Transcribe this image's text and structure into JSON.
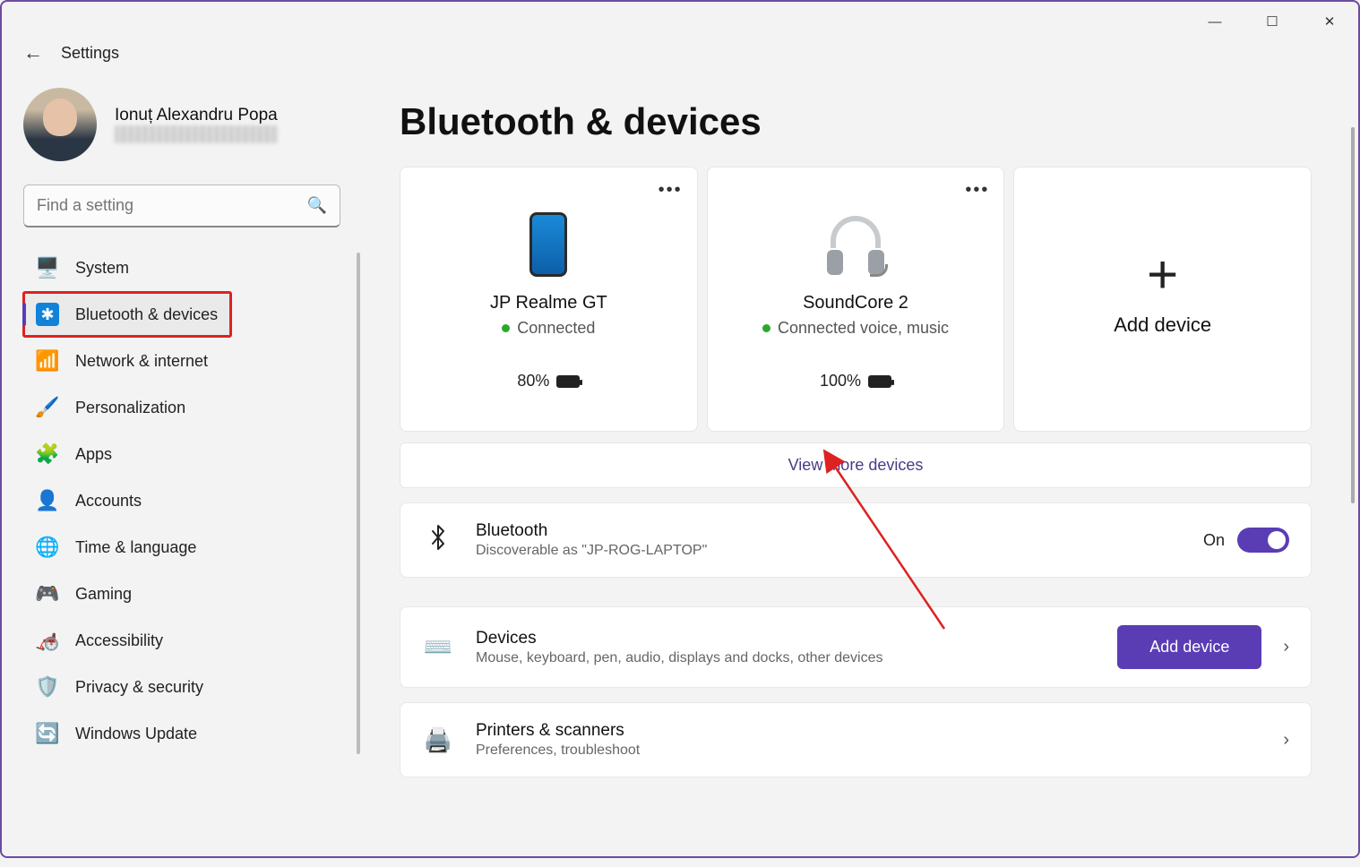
{
  "app": {
    "title": "Settings"
  },
  "user": {
    "name": "Ionuț Alexandru Popa",
    "email": "redacted"
  },
  "search": {
    "placeholder": "Find a setting"
  },
  "sidebar": {
    "items": [
      {
        "label": "System"
      },
      {
        "label": "Bluetooth & devices"
      },
      {
        "label": "Network & internet"
      },
      {
        "label": "Personalization"
      },
      {
        "label": "Apps"
      },
      {
        "label": "Accounts"
      },
      {
        "label": "Time & language"
      },
      {
        "label": "Gaming"
      },
      {
        "label": "Accessibility"
      },
      {
        "label": "Privacy & security"
      },
      {
        "label": "Windows Update"
      }
    ]
  },
  "page": {
    "title": "Bluetooth & devices"
  },
  "devices": [
    {
      "name": "JP Realme GT",
      "status": "Connected",
      "battery": "80%"
    },
    {
      "name": "SoundCore 2",
      "status": "Connected voice, music",
      "battery": "100%"
    }
  ],
  "add_device": {
    "label": "Add device"
  },
  "view_more": {
    "label": "View more devices"
  },
  "bluetooth": {
    "title": "Bluetooth",
    "sub": "Discoverable as \"JP-ROG-LAPTOP\"",
    "state": "On"
  },
  "rows": {
    "devices": {
      "title": "Devices",
      "sub": "Mouse, keyboard, pen, audio, displays and docks, other devices",
      "button": "Add device"
    },
    "printers": {
      "title": "Printers & scanners",
      "sub": "Preferences, troubleshoot"
    }
  }
}
